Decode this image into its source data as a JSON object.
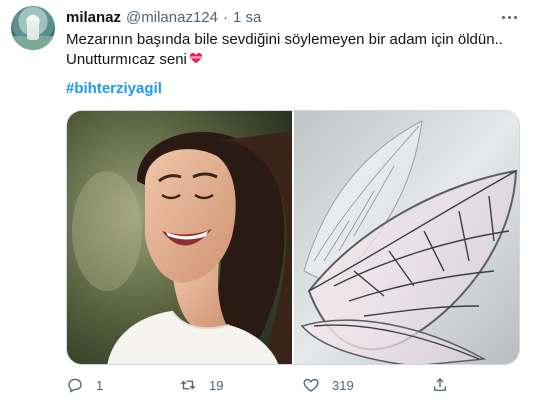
{
  "user": {
    "name": "milanaz",
    "handle": "@milanaz124",
    "separator": "·",
    "time": "1 sa"
  },
  "tweet": {
    "line1": "Mezarının başında bile sevdiğini söylemeyen bir adam için öldün..",
    "line2": "Unutturmıcaz seni",
    "hashtag": "#bihterziyagil",
    "heart_icon": "heart-with-ribbon-icon"
  },
  "media": {
    "images": [
      {
        "icon": "photo-laughing-woman"
      },
      {
        "icon": "photo-fairy-wings"
      }
    ]
  },
  "actions": {
    "reply_count": "1",
    "retweet_count": "19",
    "like_count": "319",
    "icons": [
      "reply-icon",
      "retweet-icon",
      "like-icon",
      "share-icon"
    ]
  },
  "colors": {
    "link": "#1d9bf0",
    "secondary_text": "#536471",
    "primary_text": "#0f1419"
  }
}
